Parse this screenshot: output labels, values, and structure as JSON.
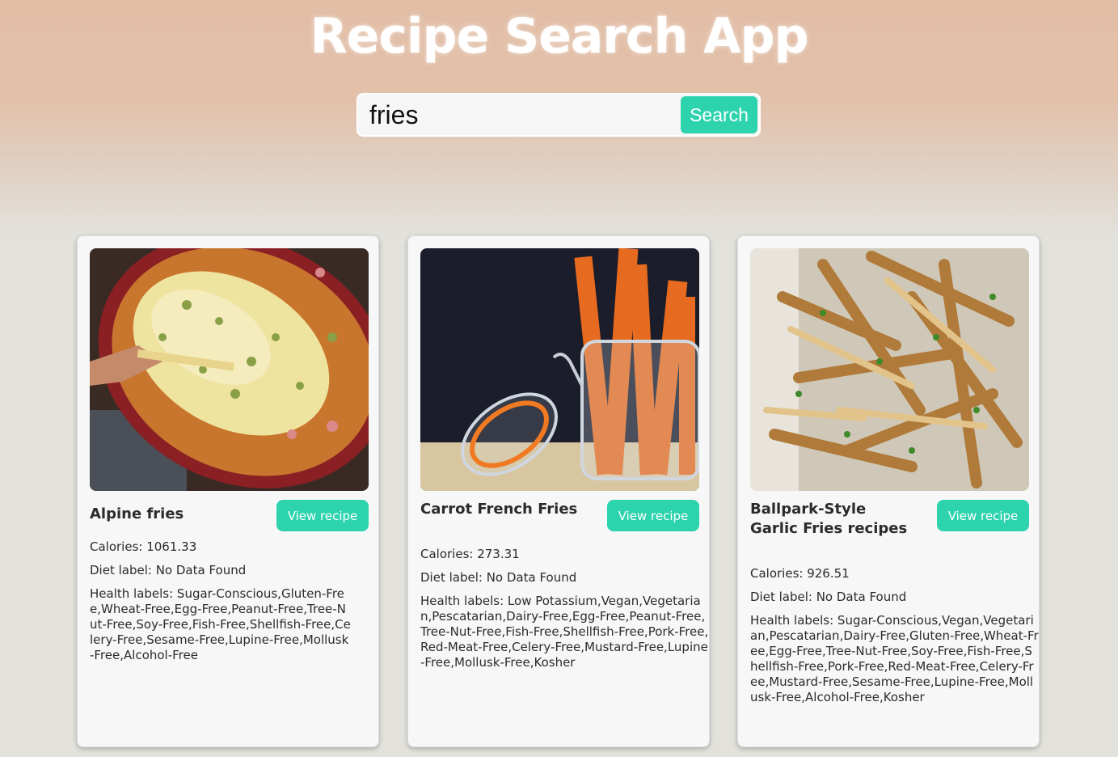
{
  "app": {
    "title": "Recipe Search App"
  },
  "search": {
    "value": "fries",
    "button_label": "Search"
  },
  "colors": {
    "accent": "#2dd3ad",
    "header_bg": "#e2bea7",
    "page_bg": "#e2e1dc"
  },
  "recipes": [
    {
      "title": "Alpine fries",
      "view_label": "View recipe",
      "calories": "Calories: 1061.33",
      "diet": "Diet label: No Data Found",
      "health": "Health labels: Sugar-Conscious,Gluten-Free,Wheat-Free,Egg-Free,Peanut-Free,Tree-Nut-Free,Soy-Free,Fish-Free,Shellfish-Free,Celery-Free,Sesame-Free,Lupine-Free,Mollusk-Free,Alcohol-Free",
      "image_icon": "gratin-dish-photo"
    },
    {
      "title": "Carrot French Fries",
      "view_label": "View recipe",
      "calories": "Calories: 273.31",
      "diet": "Diet label: No Data Found",
      "health": "Health labels: Low Potassium,Vegan,Vegetarian,Pescatarian,Dairy-Free,Egg-Free,Peanut-Free,Tree-Nut-Free,Fish-Free,Shellfish-Free,Pork-Free,Red-Meat-Free,Celery-Free,Mustard-Free,Lupine-Free,Mollusk-Free,Kosher",
      "image_icon": "carrot-jar-photo"
    },
    {
      "title": "Ballpark-Style Garlic Fries recipes",
      "view_label": "View recipe",
      "calories": "Calories: 926.51",
      "diet": "Diet label: No Data Found",
      "health": "Health labels: Sugar-Conscious,Vegan,Vegetarian,Pescatarian,Dairy-Free,Gluten-Free,Wheat-Free,Egg-Free,Tree-Nut-Free,Soy-Free,Fish-Free,Shellfish-Free,Pork-Free,Red-Meat-Free,Celery-Free,Mustard-Free,Sesame-Free,Lupine-Free,Mollusk-Free,Alcohol-Free,Kosher",
      "image_icon": "garlic-fries-photo"
    }
  ]
}
